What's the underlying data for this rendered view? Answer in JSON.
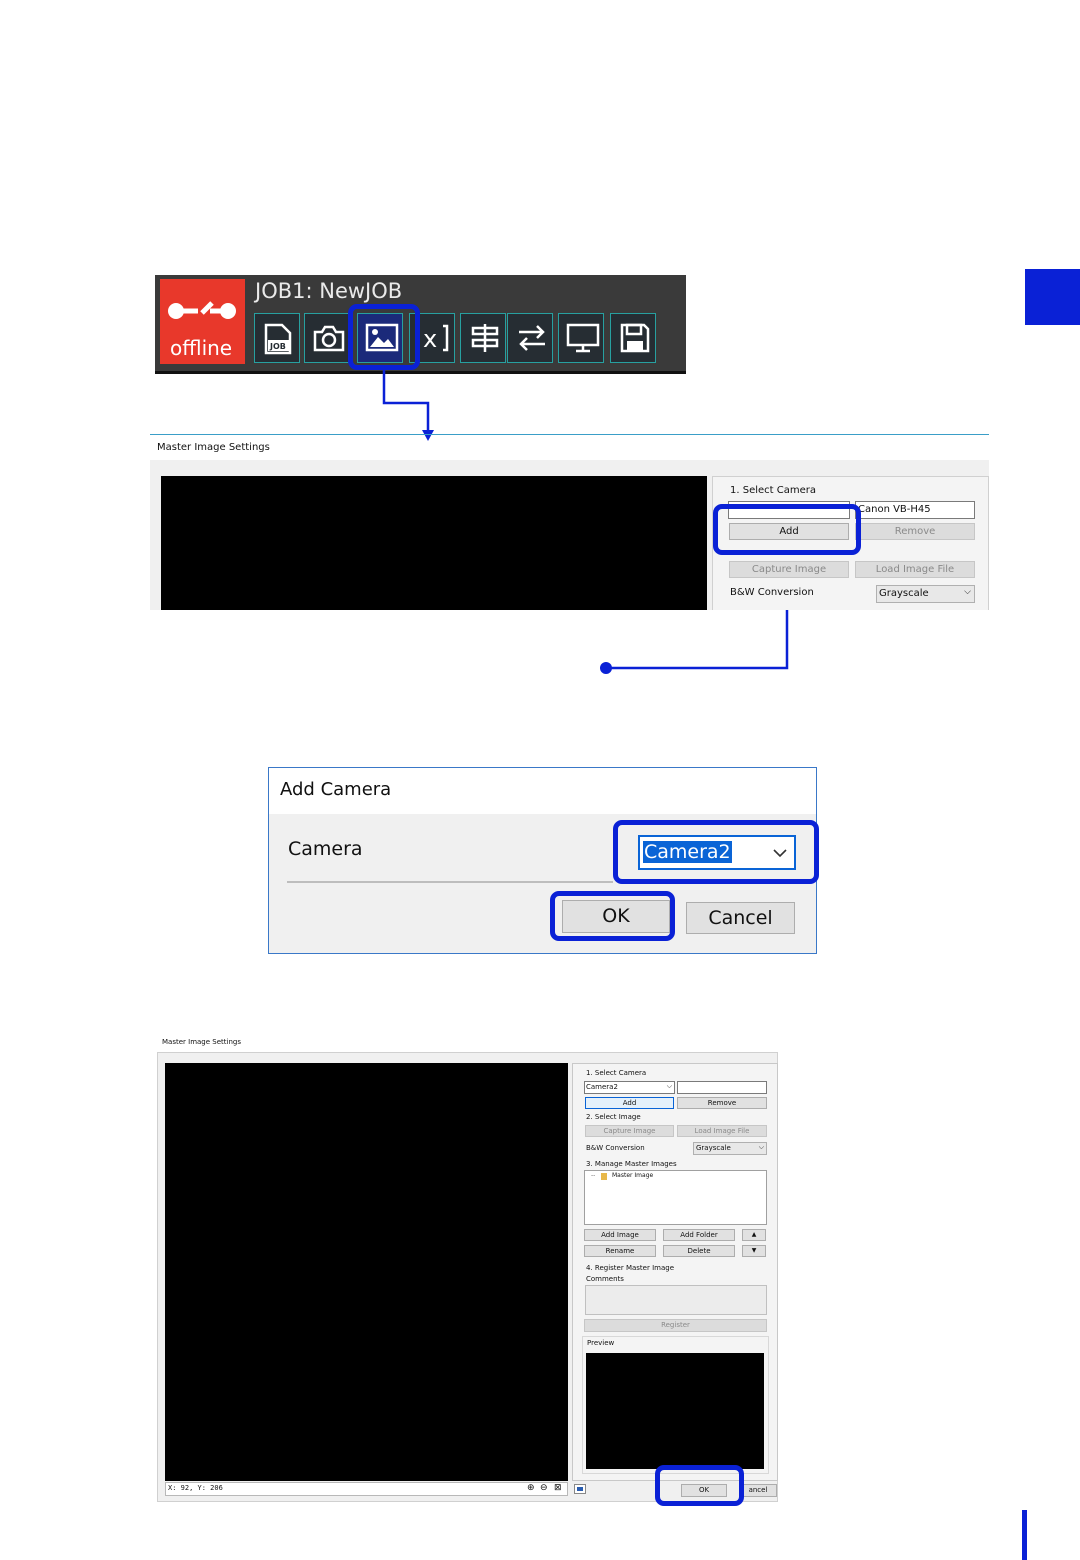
{
  "toolbar": {
    "job_title": "JOB1: NewJOB",
    "status": "offline",
    "icons": [
      "job-icon",
      "camera-icon",
      "image-icon",
      "variable-icon",
      "adjust-icon",
      "transfer-icon",
      "monitor-icon",
      "save-icon"
    ]
  },
  "master_settings_1": {
    "title": "Master Image Settings",
    "select_camera_heading": "1. Select Camera",
    "camera_value": "Canon VB-H45",
    "add_label": "Add",
    "remove_label": "Remove",
    "capture_label": "Capture Image",
    "load_label": "Load Image File",
    "bw_label": "B&W Conversion",
    "bw_value": "Grayscale"
  },
  "add_camera": {
    "title": "Add Camera",
    "camera_label": "Camera",
    "camera_value": "Camera2",
    "ok_label": "OK",
    "cancel_label": "Cancel"
  },
  "master_settings_2": {
    "title": "Master Image Settings",
    "select_camera_heading": "1. Select Camera",
    "camera_select_value": "Camera2",
    "add_label": "Add",
    "remove_label": "Remove",
    "select_image_heading": "2. Select Image",
    "capture_label": "Capture Image",
    "load_label": "Load Image File",
    "bw_label": "B&W Conversion",
    "bw_value": "Grayscale",
    "manage_heading": "3. Manage Master Images",
    "tree_item": "Master Image",
    "add_image_label": "Add Image",
    "add_folder_label": "Add Folder",
    "rename_label": "Rename",
    "delete_label": "Delete",
    "register_heading": "4. Register Master Image",
    "comments_label": "Comments",
    "register_label": "Register",
    "preview_label": "Preview",
    "coords": "X:  92, Y: 206",
    "ok_label": "OK",
    "cancel_label": "ancel"
  },
  "colors": {
    "accent": "#0a21d6",
    "brand_red": "#e8382b",
    "toolbar_bg": "#3a3a3a"
  }
}
